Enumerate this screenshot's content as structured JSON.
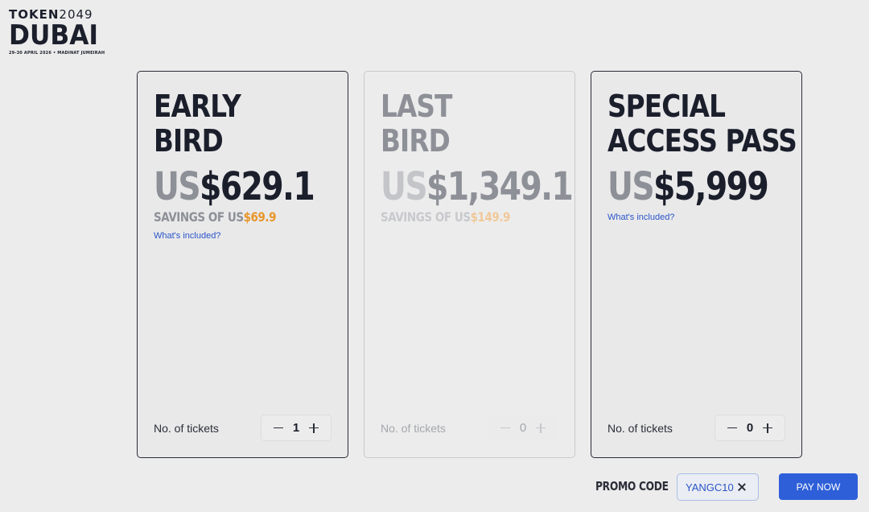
{
  "logo": {
    "token_part1": "TOKEN",
    "token_part2": "2049",
    "city": "DUBAI",
    "subtitle": "29-30 APRIL 2026 • MADINAT JUMEIRAH"
  },
  "cards": [
    {
      "title_line1": "EARLY",
      "title_line2": "BIRD",
      "currency": "US",
      "price": "$629.1",
      "savings_prefix": "SAVINGS OF US",
      "savings_amount": "$69.9",
      "included_label": "What's included?",
      "qty_label": "No. of tickets",
      "qty_value": "1",
      "disabled": false
    },
    {
      "title_line1": "LAST",
      "title_line2": "BIRD",
      "currency": "US",
      "price": "$1,349.1",
      "savings_prefix": "SAVINGS OF US",
      "savings_amount": "$149.9",
      "qty_label": "No. of tickets",
      "qty_value": "0",
      "disabled": true
    },
    {
      "title_line1": "SPECIAL",
      "title_line2": "ACCESS PASS",
      "currency": "US",
      "price": "$5,999",
      "included_label": "What's included?",
      "qty_label": "No. of tickets",
      "qty_value": "0",
      "disabled": false
    }
  ],
  "promo": {
    "label": "PROMO CODE",
    "code": "YANGC10"
  },
  "pay_button": "PAY NOW",
  "colors": {
    "accent": "#2e5fd9",
    "savings": "#e8962a",
    "background": "#ececec"
  }
}
